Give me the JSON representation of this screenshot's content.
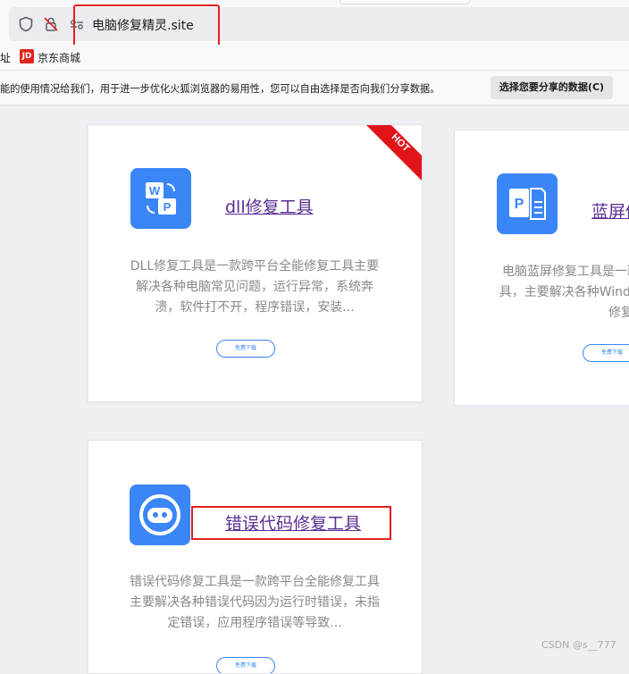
{
  "browser": {
    "url": "电脑修复精灵.site"
  },
  "bookmarks": {
    "partial": "址",
    "jd_badge": "JD",
    "jd": "京东商城"
  },
  "notice": {
    "text": "能的使用情况给我们，用于进一步优化火狐浏览器的易用性，您可以自由选择是否向我们分享数据。",
    "button": "选择您要分享的数据(C)"
  },
  "cards": [
    {
      "title": "dll修复工具",
      "desc": "DLL修复工具是一款跨平台全能修复工具主要解决各种电脑常见问题，运行异常，系统奔溃，软件打不开，程序错误，安装...",
      "button": "免费下载",
      "badge": "HOT"
    },
    {
      "title": "蓝屏修复工具",
      "desc": "电脑蓝屏修复工具是一款跨平台全能修复工具，主要解决各种Windows蓝屏问题，一键修复",
      "button": "免费下载"
    },
    {
      "title": "错误代码修复工具",
      "desc": "错误代码修复工具是一款跨平台全能修复工具主要解决各种错误代码因为运行时错误，未指定错误，应用程序错误等导致...",
      "button": "免费下载"
    }
  ],
  "watermark": "CSDN @s__777",
  "colors": {
    "highlight": "#e22020",
    "icon_blue": "#3a86f7",
    "link_purple": "#5b2d92"
  }
}
